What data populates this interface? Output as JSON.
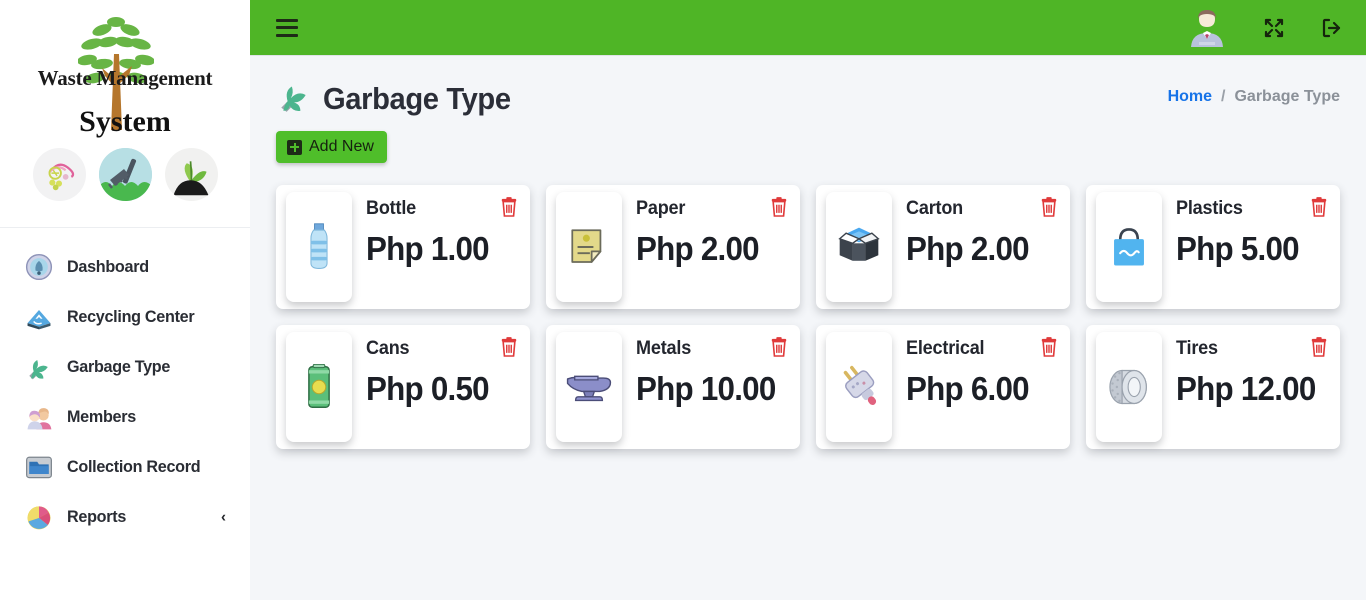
{
  "brand": {
    "line1": "Waste Management",
    "line2": "System",
    "circle_icons": [
      "recycle-flower-icon",
      "rake-grass-icon",
      "seedling-soil-icon"
    ]
  },
  "sidebar": {
    "items": [
      {
        "label": "Dashboard",
        "icon": "dashboard-gauge-icon",
        "caret": ""
      },
      {
        "label": "Recycling Center",
        "icon": "recycling-book-icon",
        "caret": ""
      },
      {
        "label": "Garbage Type",
        "icon": "garbage-leaf-icon",
        "caret": ""
      },
      {
        "label": "Members",
        "icon": "members-people-icon",
        "caret": ""
      },
      {
        "label": "Collection Record",
        "icon": "folder-icon",
        "caret": ""
      },
      {
        "label": "Reports",
        "icon": "pie-chart-icon",
        "caret": "‹"
      }
    ]
  },
  "topbar": {
    "menu_icon": "hamburger-icon",
    "avatar_icon": "user-avatar-icon",
    "fullscreen_icon": "fullscreen-expand-icon",
    "logout_icon": "sign-out-icon",
    "background_color": "#4fb526"
  },
  "page": {
    "title": "Garbage Type",
    "title_icon": "garbage-leaf-icon",
    "breadcrumb": {
      "home": "Home",
      "separator": "/",
      "current": "Garbage Type"
    },
    "add_button": {
      "label": "Add New",
      "icon": "plus-square-icon",
      "color": "#4fbe2a"
    }
  },
  "cards": [
    {
      "title": "Bottle",
      "price": "Php 1.00",
      "icon": "water-bottle-icon",
      "delete_icon": "trash-icon"
    },
    {
      "title": "Paper",
      "price": "Php 2.00",
      "icon": "paper-note-icon",
      "delete_icon": "trash-icon"
    },
    {
      "title": "Carton",
      "price": "Php 2.00",
      "icon": "open-box-icon",
      "delete_icon": "trash-icon"
    },
    {
      "title": "Plastics",
      "price": "Php 5.00",
      "icon": "shopping-bag-icon",
      "delete_icon": "trash-icon"
    },
    {
      "title": "Cans",
      "price": "Php 0.50",
      "icon": "beverage-can-icon",
      "delete_icon": "trash-icon"
    },
    {
      "title": "Metals",
      "price": "Php 10.00",
      "icon": "anvil-icon",
      "delete_icon": "trash-icon"
    },
    {
      "title": "Electrical",
      "price": "Php 6.00",
      "icon": "electric-plug-icon",
      "delete_icon": "trash-icon"
    },
    {
      "title": "Tires",
      "price": "Php 12.00",
      "icon": "tire-icon",
      "delete_icon": "trash-icon"
    }
  ]
}
